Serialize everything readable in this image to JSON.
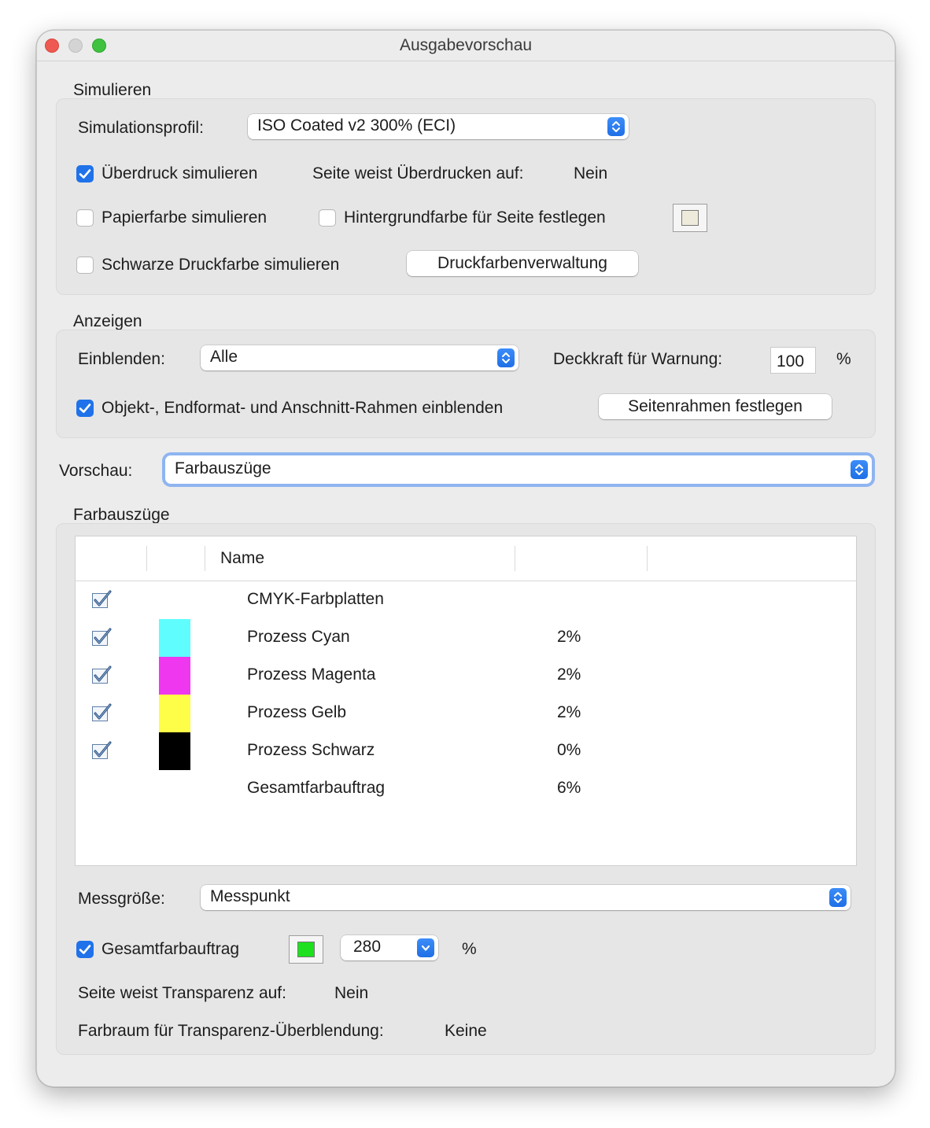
{
  "window": {
    "title": "Ausgabevorschau"
  },
  "simulieren": {
    "heading": "Simulieren",
    "profile_label": "Simulationsprofil:",
    "profile_value": "ISO Coated v2 300% (ECI)",
    "overprint_label": "Überdruck simulieren",
    "overprint_checked": true,
    "overprint_info_label": "Seite weist Überdrucken auf:",
    "overprint_info_value": "Nein",
    "paper_label": "Papierfarbe simulieren",
    "paper_checked": false,
    "background_label": "Hintergrundfarbe für Seite festlegen",
    "background_checked": false,
    "background_color": "#efebdc",
    "black_label": "Schwarze Druckfarbe simulieren",
    "black_checked": false,
    "ink_manager_button": "Druckfarbenverwaltung"
  },
  "anzeigen": {
    "heading": "Anzeigen",
    "show_label": "Einblenden:",
    "show_value": "Alle",
    "opacity_label": "Deckkraft für Warnung:",
    "opacity_value": "100",
    "opacity_unit": "%",
    "frames_label": "Objekt-, Endformat- und Anschnitt-Rahmen einblenden",
    "frames_checked": true,
    "page_boxes_button": "Seitenrahmen festlegen"
  },
  "vorschau": {
    "label": "Vorschau:",
    "value": "Farbauszüge"
  },
  "farbauszuege": {
    "heading": "Farbauszüge",
    "columns": [
      "",
      "",
      "Name",
      "",
      ""
    ],
    "rows": [
      {
        "checked": true,
        "color": "",
        "name": "CMYK-Farbplatten",
        "value": ""
      },
      {
        "checked": true,
        "color": "#5ffdfe",
        "name": "Prozess Cyan",
        "value": "2%"
      },
      {
        "checked": true,
        "color": "#ee37ef",
        "name": "Prozess Magenta",
        "value": "2%"
      },
      {
        "checked": true,
        "color": "#fefd47",
        "name": "Prozess Gelb",
        "value": "2%"
      },
      {
        "checked": true,
        "color": "#000000",
        "name": "Prozess Schwarz",
        "value": "0%"
      },
      {
        "checked": false,
        "color": "",
        "name": "Gesamtfarbauftrag",
        "value": "6%"
      }
    ],
    "sample_size_label": "Messgröße:",
    "sample_size_value": "Messpunkt",
    "total_coverage_label": "Gesamtfarbauftrag",
    "total_coverage_checked": true,
    "total_coverage_color": "#1ee01e",
    "total_coverage_value": "280",
    "total_coverage_unit": "%",
    "transparency_label": "Seite weist Transparenz auf:",
    "transparency_value": "Nein",
    "blend_space_label": "Farbraum für Transparenz-Überblendung:",
    "blend_space_value": "Keine"
  }
}
